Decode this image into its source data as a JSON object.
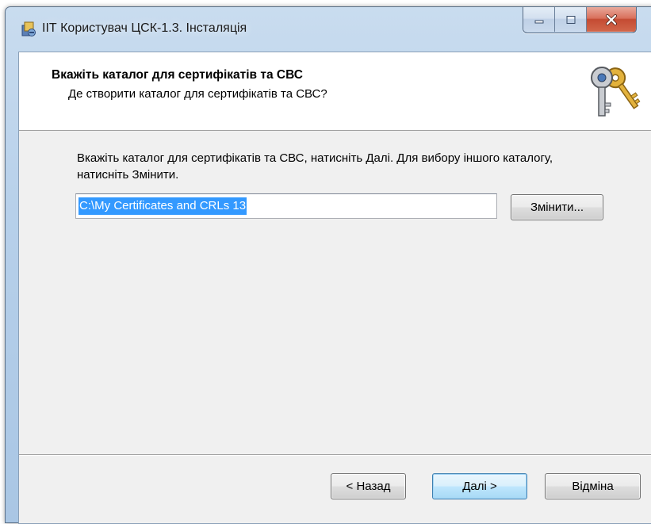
{
  "window": {
    "title": "ІІТ Користувач ЦСК-1.3. Інсталяція"
  },
  "header": {
    "title": "Вкажіть каталог для сертифікатів та СВС",
    "subtitle": "Де створити каталог для сертифікатів та СВС?"
  },
  "body": {
    "instruction": "Вкажіть каталог для сертифікатів та СВС, натисніть Далі. Для вибору іншого каталогу, натисніть Змінити.",
    "path_value": "C:\\My Certificates and CRLs 13",
    "change_button": "Змінити..."
  },
  "footer": {
    "back_button": "< Назад",
    "next_button": "Далі >",
    "cancel_button": "Відміна"
  },
  "icons": {
    "app": "installer-icon",
    "header": "keys-icon",
    "minimize": "minimize-icon",
    "maximize": "maximize-icon",
    "close": "close-icon"
  },
  "colors": {
    "selection": "#3399ff",
    "close_button": "#c44b33"
  }
}
